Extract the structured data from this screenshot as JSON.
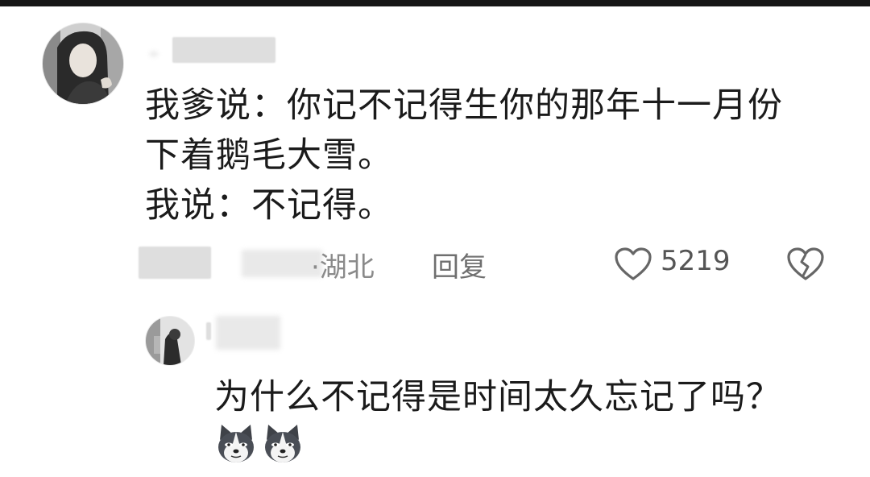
{
  "comment": {
    "lines": [
      "我爹说：你记不记得生你的那年十一月份",
      "下着鹅毛大雪。",
      "我说：不记得。"
    ],
    "location": "·湖北",
    "reply_label": "回复",
    "likes": "5219",
    "icons": {
      "like": "heart-outline-icon",
      "dislike": "broken-heart-icon"
    }
  },
  "reply": {
    "text": "为什么不记得是时间太久忘记了吗？",
    "emoji": [
      "husky-emoji",
      "husky-emoji"
    ]
  }
}
